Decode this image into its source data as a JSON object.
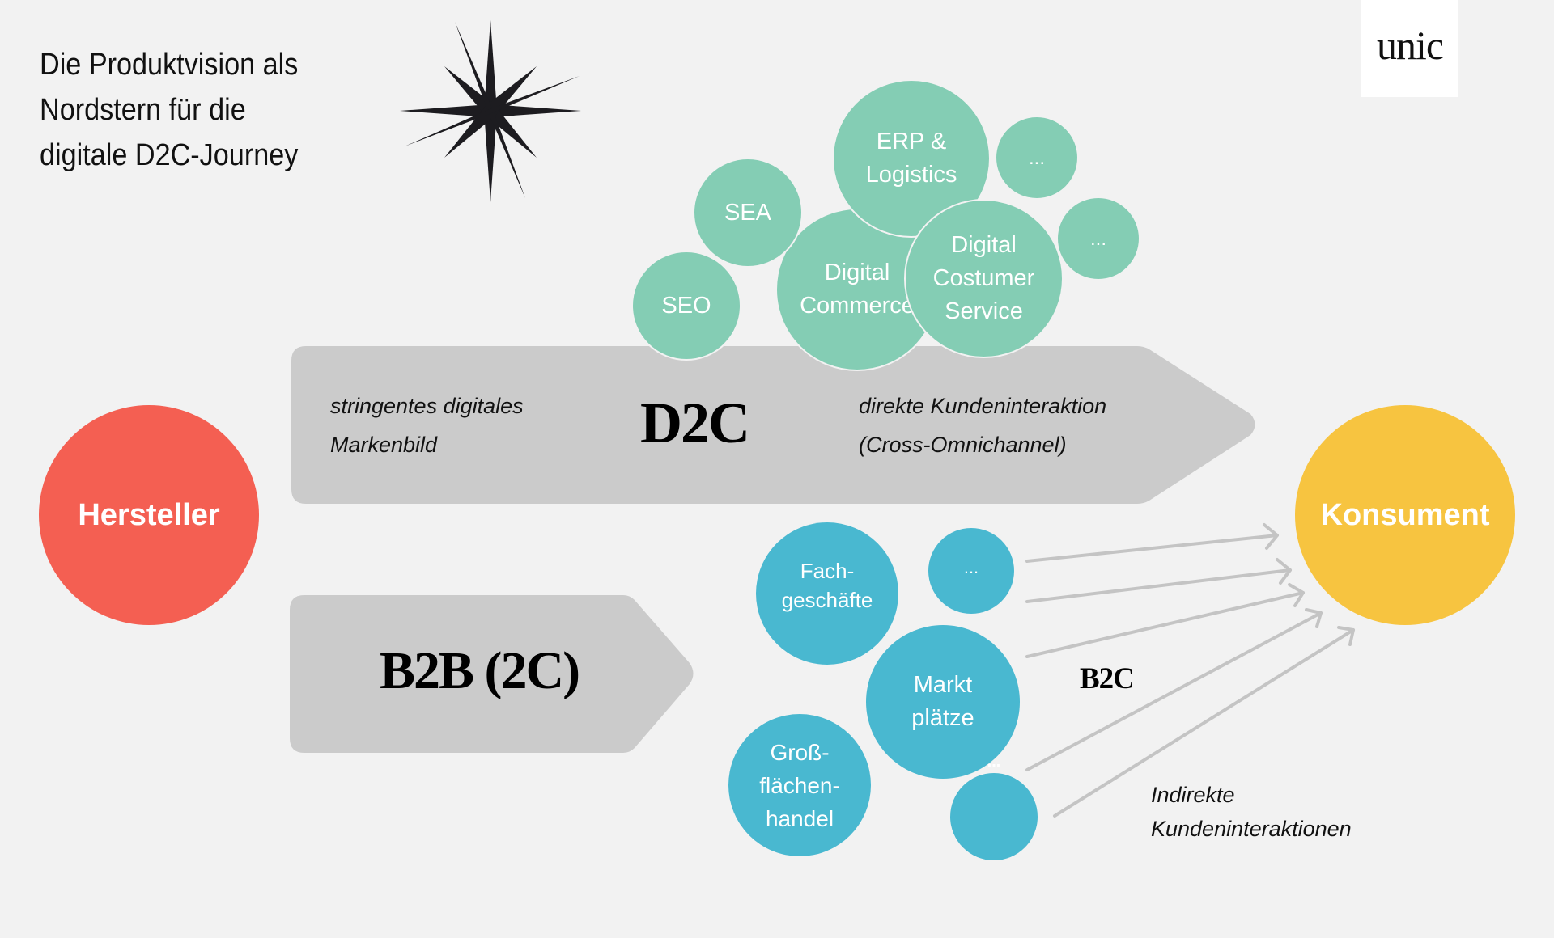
{
  "title": {
    "lines": [
      "Die Produktvision als",
      "Nordstern für die",
      "digitale D2C-Journey"
    ]
  },
  "logo": {
    "text": "unic"
  },
  "icons": {
    "star": "north-star-icon"
  },
  "nodes": {
    "manufacturer": {
      "label": "Hersteller",
      "color": "#f45f52"
    },
    "consumer": {
      "label": "Konsument",
      "color": "#f7c440"
    }
  },
  "d2c": {
    "label": "D2C",
    "left_text": [
      "stringentes digitales",
      "Markenbild"
    ],
    "right_text": [
      "direkte Kundeninteraktion",
      "(Cross-Omnichannel)"
    ],
    "bubbles": [
      {
        "label": "SEO"
      },
      {
        "label": "Digital\nCommerce"
      },
      {
        "label": "SEA"
      },
      {
        "label": "ERP &\nLogistics"
      },
      {
        "label": "Digital\nCostumer\nService"
      },
      {
        "label": "..."
      },
      {
        "label": "..."
      }
    ],
    "bubble_color": "#84cdb4"
  },
  "b2b": {
    "label": "B2B (2C)",
    "b2c_label": "B2C",
    "bubbles": [
      {
        "label": "Fach-\ngeschäfte"
      },
      {
        "label": "..."
      },
      {
        "label": "Markt\nplätze"
      },
      {
        "label": "Groß-\nflächen-\nhandel"
      },
      {
        "label": "..."
      }
    ],
    "bubble_color": "#49b8d0",
    "indirect_text": [
      "Indirekte",
      "Kundeninteraktionen"
    ]
  },
  "colors": {
    "background": "#f2f2f2",
    "band": "#cbcbcb",
    "arrow_line": "#c4c4c4"
  }
}
